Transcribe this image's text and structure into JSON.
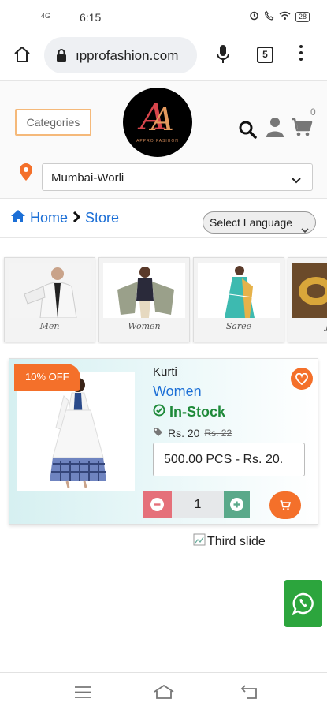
{
  "status_bar": {
    "signal_text": "4G",
    "time": "6:15",
    "battery": "28"
  },
  "browser": {
    "url": "ıpprofashion.com",
    "tab_count": "5"
  },
  "header": {
    "categories_label": "Categories",
    "cart_count": "0",
    "logo_brand": "APPRO FASHION"
  },
  "location": {
    "selected": "Mumbai-Worli"
  },
  "breadcrumb": {
    "home": "Home",
    "current": "Store"
  },
  "language": {
    "label": "Select Language"
  },
  "category_strip": [
    {
      "label": "Men"
    },
    {
      "label": "Women"
    },
    {
      "label": "Saree"
    },
    {
      "label": "Jew"
    }
  ],
  "product": {
    "discount": "10% OFF",
    "name": "Kurti",
    "category": "Women",
    "stock": "In-Stock",
    "price": "Rs. 20",
    "old_price": "Rs. 22",
    "pack_option": "500.00 PCS - Rs. 20.",
    "quantity": "1"
  },
  "carousel": {
    "alt_text": "Third slide"
  },
  "colors": {
    "accent_orange": "#f4702a",
    "link_blue": "#1c6fd6",
    "stock_green": "#1f8a3a",
    "whatsapp_green": "#2ca53d",
    "minus_red": "#e5707a",
    "plus_green": "#5aa98a"
  }
}
